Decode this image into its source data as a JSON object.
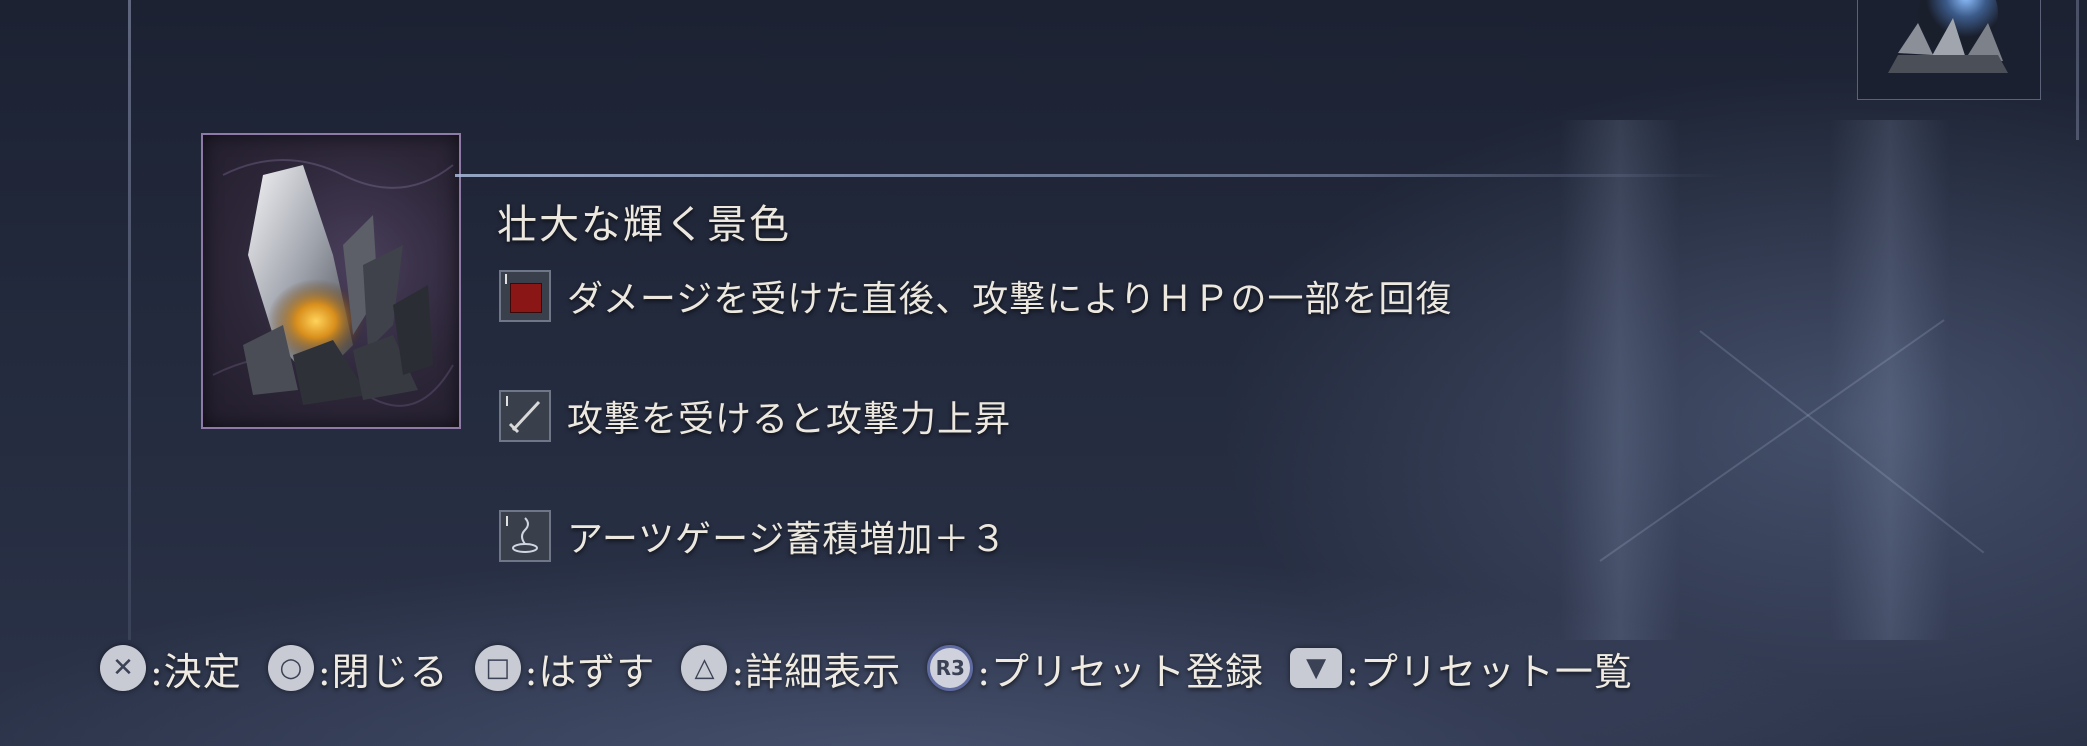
{
  "item": {
    "name": "壮大な輝く景色",
    "icon": "crystal-shard-icon"
  },
  "effects": [
    {
      "icon": "hp-recovery-icon",
      "text": "ダメージを受けた直後、攻撃によりＨＰの一部を回復"
    },
    {
      "icon": "sword-attack-up-icon",
      "text": "攻撃を受けると攻撃力上昇"
    },
    {
      "icon": "arts-gauge-icon",
      "text": "アーツゲージ蓄積増加＋３"
    }
  ],
  "controls": [
    {
      "glyph": "✕",
      "label": ":決定"
    },
    {
      "glyph": "○",
      "label": ":閉じる"
    },
    {
      "glyph": "□",
      "label": ":はずす"
    },
    {
      "glyph": "△",
      "label": ":詳細表示"
    },
    {
      "glyph": "R3",
      "label": ":プリセット登録"
    },
    {
      "glyph": "▼",
      "label": ":プリセット一覧"
    }
  ],
  "colors": {
    "frame_accent": "#8d7aa6",
    "text": "#ece8df",
    "button_glyph": "#c8cad4"
  }
}
